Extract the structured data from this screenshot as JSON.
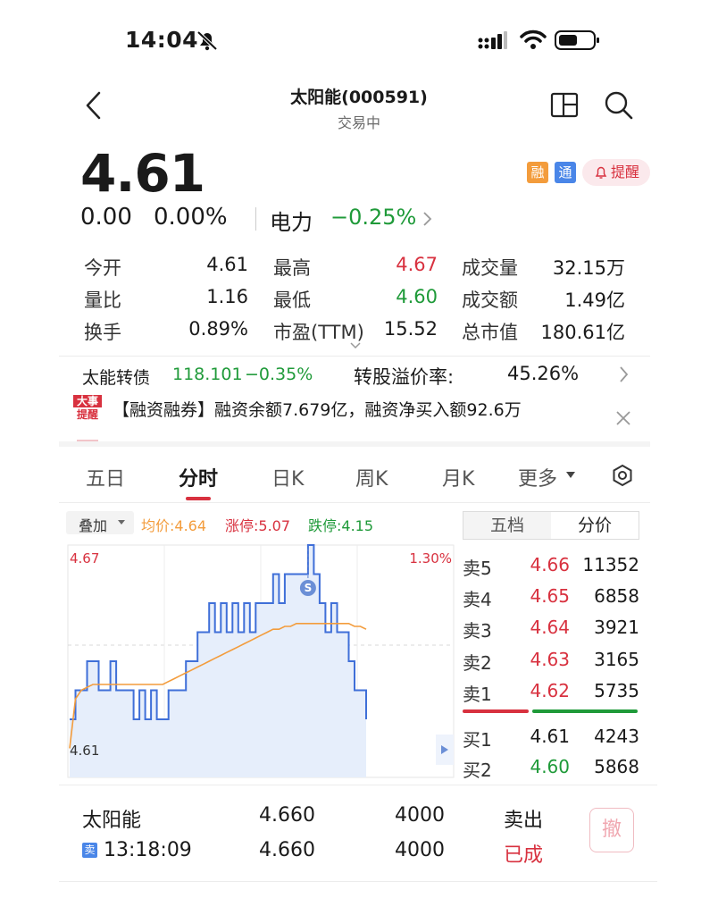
{
  "status_bar": {
    "time": "14:04"
  },
  "header": {
    "title": "太阳能(000591)",
    "subtitle": "交易中"
  },
  "quote": {
    "price": "4.61",
    "change": "0.00",
    "change_pct": "0.00%",
    "sector_name": "电力",
    "sector_change": "−0.25%",
    "badges": {
      "rong": "融",
      "tong": "通"
    },
    "remind_label": "提醒"
  },
  "stats": {
    "rows": [
      [
        {
          "label": "今开",
          "value": "4.61"
        },
        {
          "label": "最高",
          "value": "4.67"
        },
        {
          "label": "成交量",
          "value": "32.15万"
        }
      ],
      [
        {
          "label": "量比",
          "value": "1.16"
        },
        {
          "label": "最低",
          "value": "4.60"
        },
        {
          "label": "成交额",
          "value": "1.49亿"
        }
      ],
      [
        {
          "label": "换手",
          "value": "0.89%"
        },
        {
          "label": "市盈(TTM)",
          "value": "15.52"
        },
        {
          "label": "总市值",
          "value": "180.61亿"
        }
      ]
    ]
  },
  "bond": {
    "name": "太能转债",
    "price": "118.101",
    "change": "−0.35%",
    "premium_label": "转股溢价率:",
    "premium_value": "45.26%"
  },
  "news": {
    "tag_top": "大事",
    "tag_bottom": "提醒",
    "text": "【融资融券】融资余额7.679亿，融资净买入额92.6万"
  },
  "tabs": [
    "五日",
    "分时",
    "日K",
    "周K",
    "月K",
    "更多"
  ],
  "chart_controls": {
    "overlay": "叠加",
    "avg": "均价:4.64",
    "limit_up": "涨停:5.07",
    "limit_down": "跌停:4.15",
    "marker": "S"
  },
  "chart_data": {
    "type": "line",
    "y_left_labels": [
      "4.67",
      "4.61"
    ],
    "y_right_labels": [
      "1.30%"
    ],
    "ylim": [
      4.59,
      4.67
    ],
    "series": [
      {
        "name": "price",
        "color": "#3f6fd8",
        "values": [
          4.61,
          4.62,
          4.62,
          4.63,
          4.63,
          4.62,
          4.62,
          4.63,
          4.62,
          4.62,
          4.62,
          4.61,
          4.62,
          4.61,
          4.62,
          4.61,
          4.61,
          4.62,
          4.62,
          4.62,
          4.63,
          4.63,
          4.64,
          4.64,
          4.65,
          4.64,
          4.65,
          4.64,
          4.65,
          4.64,
          4.65,
          4.64,
          4.65,
          4.65,
          4.65,
          4.66,
          4.65,
          4.66,
          4.66,
          4.66,
          4.66,
          4.67,
          4.66,
          4.65,
          4.64,
          4.65,
          4.64,
          4.64,
          4.63,
          4.62,
          4.62,
          4.61
        ]
      },
      {
        "name": "avg",
        "color": "#f39c3c",
        "values": [
          4.6,
          4.617,
          4.62,
          4.621,
          4.622,
          4.622,
          4.622,
          4.622,
          4.622,
          4.622,
          4.622,
          4.622,
          4.622,
          4.622,
          4.622,
          4.622,
          4.622,
          4.623,
          4.624,
          4.625,
          4.626,
          4.627,
          4.628,
          4.629,
          4.63,
          4.631,
          4.632,
          4.633,
          4.634,
          4.635,
          4.636,
          4.637,
          4.638,
          4.639,
          4.64,
          4.641,
          4.641,
          4.642,
          4.642,
          4.643,
          4.643,
          4.643,
          4.643,
          4.643,
          4.643,
          4.643,
          4.643,
          4.643,
          4.643,
          4.642,
          4.642,
          4.641
        ]
      }
    ]
  },
  "side_tabs": [
    "五档",
    "分价"
  ],
  "order_book": {
    "asks": [
      {
        "label": "卖5",
        "price": "4.66",
        "volume": "11352"
      },
      {
        "label": "卖4",
        "price": "4.65",
        "volume": "6858"
      },
      {
        "label": "卖3",
        "price": "4.64",
        "volume": "3921"
      },
      {
        "label": "卖2",
        "price": "4.63",
        "volume": "3165"
      },
      {
        "label": "卖1",
        "price": "4.62",
        "volume": "5735"
      }
    ],
    "bids": [
      {
        "label": "买1",
        "price": "4.61",
        "volume": "4243"
      },
      {
        "label": "买2",
        "price": "4.60",
        "volume": "5868"
      }
    ]
  },
  "order": {
    "name": "太阳能",
    "badge": "卖",
    "time": "13:18:09",
    "price1": "4.660",
    "price2": "4.660",
    "qty1": "4000",
    "qty2": "4000",
    "type": "卖出",
    "status": "已成",
    "cancel_label": "撤"
  }
}
